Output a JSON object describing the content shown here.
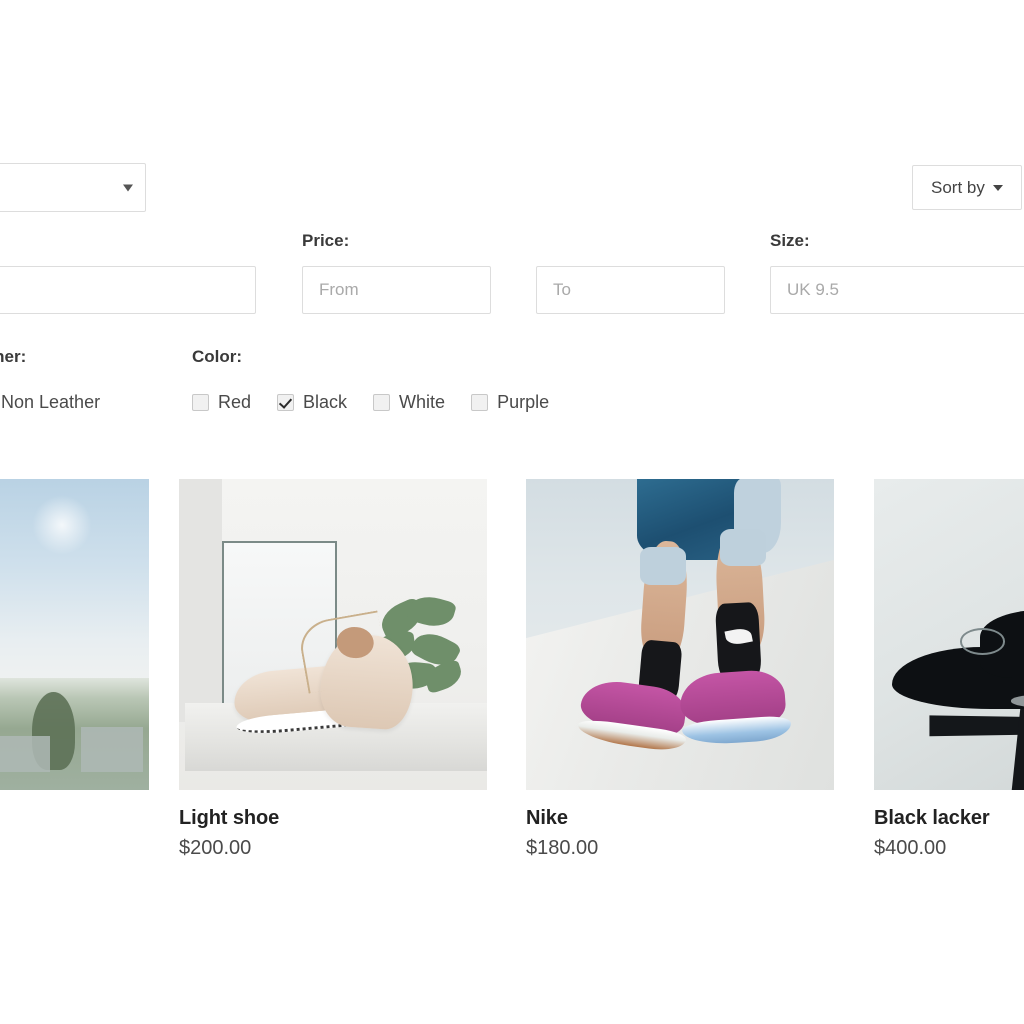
{
  "toolbar": {
    "category_select": {
      "value": "",
      "icon": "chevron-down-icon"
    },
    "sort_button": {
      "label": "Sort by",
      "icon": "caret-down-icon"
    }
  },
  "filters": {
    "brand": {
      "label": "",
      "value": "",
      "placeholder": ""
    },
    "price": {
      "label": "Price:",
      "from": {
        "value": "",
        "placeholder": "From"
      },
      "to": {
        "value": "",
        "placeholder": "To"
      }
    },
    "size": {
      "label": "Size:",
      "value": "",
      "placeholder": "UK 9.5"
    },
    "leather": {
      "label": "ather:",
      "options": [
        {
          "label": "Non Leather",
          "checked": false
        }
      ]
    },
    "color": {
      "label": "Color:",
      "options": [
        {
          "label": "Red",
          "checked": false
        },
        {
          "label": "Black",
          "checked": true
        },
        {
          "label": "White",
          "checked": false
        },
        {
          "label": "Purple",
          "checked": false
        }
      ]
    }
  },
  "products": [
    {
      "title": "",
      "price": "",
      "image_alt": "red-running-shoe-in-sky"
    },
    {
      "title": "Light shoe",
      "price": "$200.00",
      "image_alt": "light-beige-sneakers-with-plant"
    },
    {
      "title": "Nike",
      "price": "$180.00",
      "image_alt": "legs-wearing-pink-nike-sneakers"
    },
    {
      "title": "Black lacker",
      "price": "$400.00",
      "image_alt": "black-dress-shoe-on-table"
    }
  ],
  "colors": {
    "background": "#ffffff",
    "text": "#333333",
    "border": "#dddddd",
    "placeholder": "#a9a9a9"
  }
}
